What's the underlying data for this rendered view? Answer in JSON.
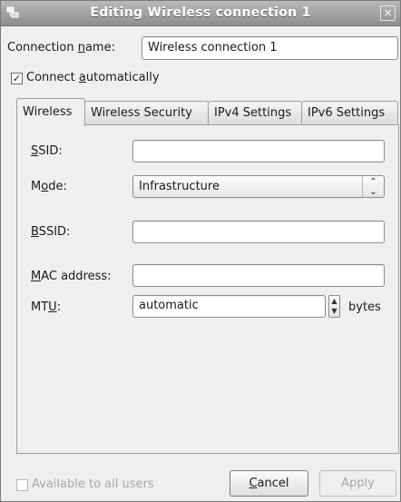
{
  "window": {
    "title": "Editing Wireless connection 1",
    "close_glyph": "×"
  },
  "connection": {
    "name_label_pre": "Connection ",
    "name_label_mnemonic": "n",
    "name_label_post": "ame:",
    "name_value": "Wireless connection 1",
    "connect_auto_pre": "Connect ",
    "connect_auto_mnemonic": "a",
    "connect_auto_post": "utomatically",
    "connect_auto_checked": true
  },
  "tabs": [
    {
      "label": "Wireless",
      "active": true
    },
    {
      "label": "Wireless Security",
      "active": false
    },
    {
      "label": "IPv4 Settings",
      "active": false
    },
    {
      "label": "IPv6 Settings",
      "active": false
    }
  ],
  "wireless": {
    "ssid_label_mnemonic": "S",
    "ssid_label_post": "SID:",
    "ssid_value": "",
    "mode_label_pre": "M",
    "mode_label_mnemonic": "o",
    "mode_label_post": "de:",
    "mode_value": "Infrastructure",
    "bssid_label_mnemonic": "B",
    "bssid_label_post": "SSID:",
    "bssid_value": "",
    "mac_label_mnemonic": "M",
    "mac_label_post": "AC address:",
    "mac_value": "",
    "mtu_label_pre": "MT",
    "mtu_label_mnemonic": "U",
    "mtu_label_post": ":",
    "mtu_value": "automatic",
    "mtu_unit": "bytes"
  },
  "footer": {
    "available_all_users": "Available to all users",
    "available_checked": false,
    "cancel_mnemonic": "C",
    "cancel_post": "ancel",
    "apply": "Apply"
  },
  "icons": {
    "app": "network-connection-icon",
    "checkmark": "☑",
    "spin_up": "▲",
    "spin_down": "▼",
    "combo_up": "⌃",
    "combo_down": "⌄"
  },
  "colors": {
    "titlebar": "#9e9e9e",
    "window_bg": "#efefef",
    "disabled_text": "#a8a8a8"
  }
}
